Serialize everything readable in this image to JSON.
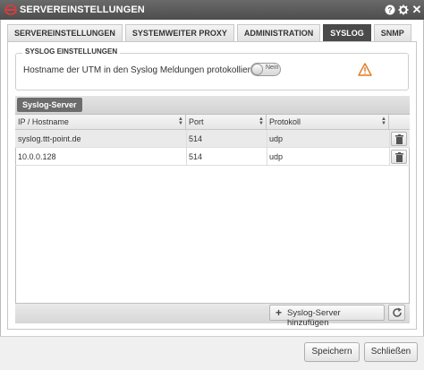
{
  "window": {
    "title": "SERVEREINSTELLUNGEN",
    "help_icon": "question-mark-icon",
    "settings_icon": "gear-icon",
    "close_icon": "close-icon"
  },
  "tabs": [
    {
      "label": "SERVEREINSTELLUNGEN",
      "active": false
    },
    {
      "label": "SYSTEMWEITER PROXY",
      "active": false
    },
    {
      "label": "ADMINISTRATION",
      "active": false
    },
    {
      "label": "SYSLOG",
      "active": true
    },
    {
      "label": "SNMP",
      "active": false
    }
  ],
  "syslog_settings": {
    "legend": "SYSLOG EINSTELLUNGEN",
    "hostname_label": "Hostname der UTM in den Syslog Meldungen protokollieren:",
    "toggle_value": "Nein",
    "warning_icon": "warning-triangle-icon",
    "warning_color": "#e07a20"
  },
  "syslog_server": {
    "title": "Syslog-Server",
    "columns": [
      "IP / Hostname",
      "Port",
      "Protokoll"
    ],
    "rows": [
      {
        "host": "syslog.ttt-point.de",
        "port": "514",
        "protocol": "udp"
      },
      {
        "host": "10.0.0.128",
        "port": "514",
        "protocol": "udp"
      }
    ],
    "add_label": "Syslog-Server hinzufügen",
    "refresh_icon": "refresh-icon",
    "delete_icon": "trash-icon"
  },
  "footer": {
    "save_label": "Speichern",
    "close_label": "Schließen"
  }
}
